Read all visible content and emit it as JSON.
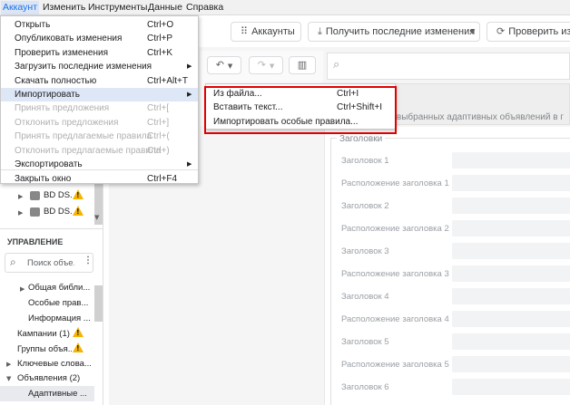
{
  "menubar": {
    "items": [
      "Аккаунт",
      "Изменить",
      "Инструменты",
      "Данные",
      "Справка"
    ]
  },
  "toolbar": {
    "accounts_label": "Аккаунты",
    "get_changes_label": "Получить последние изменения",
    "check_changes_label": "Проверить изм"
  },
  "account_menu": {
    "items": [
      {
        "label": "Открыть",
        "shortcut": "Ctrl+O"
      },
      {
        "label": "Опубликовать изменения",
        "shortcut": "Ctrl+P"
      },
      {
        "label": "Проверить изменения",
        "shortcut": "Ctrl+K"
      },
      {
        "label": "Загрузить последние изменения",
        "shortcut": ""
      },
      {
        "label": "Скачать полностью",
        "shortcut": "Ctrl+Alt+T"
      },
      {
        "label": "Импортировать",
        "shortcut": ""
      },
      {
        "label": "Принять предложения",
        "shortcut": "Ctrl+["
      },
      {
        "label": "Отклонить предложения",
        "shortcut": "Ctrl+]"
      },
      {
        "label": "Принять предлагаемые правила",
        "shortcut": "Ctrl+("
      },
      {
        "label": "Отклонить предлагаемые правила",
        "shortcut": "Ctrl+)"
      },
      {
        "label": "Экспортировать",
        "shortcut": ""
      },
      {
        "label": "Закрыть окно",
        "shortcut": "Ctrl+F4"
      }
    ]
  },
  "import_submenu": {
    "items": [
      {
        "label": "Из файла...",
        "shortcut": "Ctrl+I"
      },
      {
        "label": "Вставить текст...",
        "shortcut": "Ctrl+Shift+I"
      },
      {
        "label": "Импортировать особые правила...",
        "shortcut": ""
      }
    ]
  },
  "tree": {
    "items": [
      {
        "label": "BD DS..."
      },
      {
        "label": "BD DS..."
      }
    ]
  },
  "management": {
    "heading": "УПРАВЛЕНИЕ",
    "search_placeholder": "Поиск объе...",
    "items": [
      {
        "label": "Общая библи..."
      },
      {
        "label": "Особые прав..."
      },
      {
        "label": "Информация ..."
      },
      {
        "label": "Кампании (1)"
      },
      {
        "label": "Группы объя..."
      },
      {
        "label": "Ключевые слова..."
      },
      {
        "label": "Объявления (2)"
      },
      {
        "label": "Адаптивные ..."
      }
    ]
  },
  "main": {
    "banner_text": "ие выбранных адаптивных объявлений в г",
    "section_title": "Заголовки",
    "fields": [
      {
        "label": "Заголовок 1"
      },
      {
        "label": "Расположение заголовка 1"
      },
      {
        "label": "Заголовок 2"
      },
      {
        "label": "Расположение заголовка 2"
      },
      {
        "label": "Заголовок 3"
      },
      {
        "label": "Расположение заголовка 3"
      },
      {
        "label": "Заголовок 4"
      },
      {
        "label": "Расположение заголовка 4"
      },
      {
        "label": "Заголовок 5"
      },
      {
        "label": "Расположение заголовка 5"
      },
      {
        "label": "Заголовок 6"
      }
    ]
  },
  "colors": {
    "highlight": "#dde7f6",
    "accent": "#1a73e8",
    "red_box": "#e00000",
    "warning": "#f4b400"
  }
}
